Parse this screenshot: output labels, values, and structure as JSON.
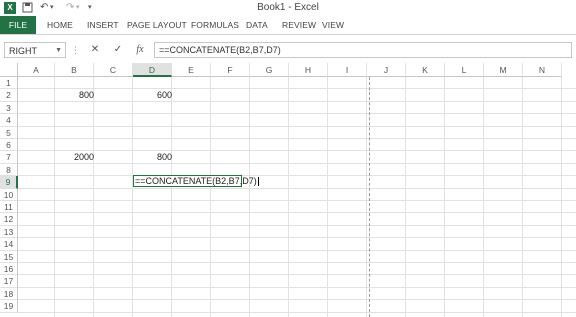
{
  "window": {
    "title": "Book1 - Excel",
    "logo": "X",
    "undo_label": "↶",
    "redo_label": "↷",
    "customize_label": "▾"
  },
  "ribbon": {
    "tabs": [
      "FILE",
      "HOME",
      "INSERT",
      "PAGE LAYOUT",
      "FORMULAS",
      "DATA",
      "REVIEW",
      "VIEW"
    ]
  },
  "formula_bar": {
    "name_box": "RIGHT",
    "cancel_label": "✕",
    "enter_label": "✓",
    "fx_label": "fx",
    "content": "==CONCATENATE(B2,B7,D7)"
  },
  "grid": {
    "columns": [
      "A",
      "B",
      "C",
      "D",
      "E",
      "F",
      "G",
      "H",
      "I",
      "J",
      "K",
      "L",
      "M",
      "N"
    ],
    "active_column": "D",
    "rows": [
      "1",
      "2",
      "3",
      "4",
      "5",
      "6",
      "7",
      "8",
      "9",
      "10",
      "11",
      "12",
      "13",
      "14",
      "15",
      "16",
      "17",
      "18",
      "19"
    ],
    "active_row": "9",
    "cells": {
      "B2": "800",
      "D2": "600",
      "B7": "2000",
      "D7": "800"
    },
    "editing_cell_ref": "D9",
    "editing_content": "==CONCATENATE(B2,B7,D7)"
  },
  "colors": {
    "accent": "#217346",
    "gridline": "#e1e1e1"
  }
}
